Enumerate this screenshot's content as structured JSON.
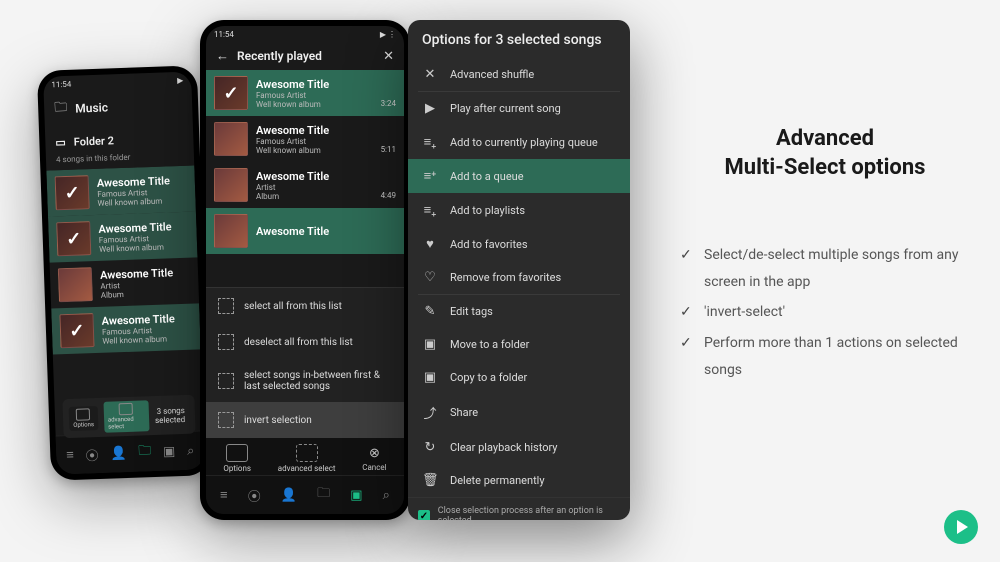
{
  "marketing": {
    "title_line1": "Advanced",
    "title_line2": "Multi-Select options",
    "bullets": [
      "Select/de-select multiple songs from any screen in the app",
      "'invert-select'",
      "Perform more than 1 actions on selected songs"
    ]
  },
  "phone1": {
    "status_time": "11:54",
    "breadcrumb": "Music",
    "folder_name": "Folder 2",
    "subtitle": "4 songs in this folder",
    "songs": [
      {
        "title": "Awesome Title",
        "artist": "Famous Artist",
        "album": "Well known album",
        "selected": true
      },
      {
        "title": "Awesome Title",
        "artist": "Famous Artist",
        "album": "Well known album",
        "selected": true
      },
      {
        "title": "Awesome Title",
        "artist": "Artist",
        "album": "Album",
        "selected": false
      },
      {
        "title": "Awesome Title",
        "artist": "Famous Artist",
        "album": "Well known album",
        "selected": true
      }
    ],
    "selection_label": "3 songs selected",
    "options_label": "Options",
    "advanced_select_label": "advanced select"
  },
  "phone2": {
    "status_time": "11:54",
    "header_title": "Recently played",
    "songs": [
      {
        "title": "Awesome Title",
        "artist": "Famous Artist",
        "album": "Well known album",
        "duration": "3:24",
        "selected": true
      },
      {
        "title": "Awesome Title",
        "artist": "Famous Artist",
        "album": "Well known album",
        "duration": "5:11",
        "selected": false
      },
      {
        "title": "Awesome Title",
        "artist": "Artist",
        "album": "Album",
        "duration": "4:49",
        "selected": false
      },
      {
        "title": "Awesome Title",
        "artist": "",
        "album": "",
        "duration": "",
        "selected": true
      }
    ],
    "sel_options": [
      "select all from this list",
      "deselect all from this list",
      "select songs in-between first & last selected songs",
      "invert selection"
    ],
    "bottom_options": "Options",
    "bottom_advanced": "advanced select",
    "bottom_cancel": "Cancel"
  },
  "panel3": {
    "header": "Options for 3 selected songs",
    "options": [
      {
        "icon": "shuffle-icon",
        "glyph": "✕",
        "label": "Advanced shuffle"
      },
      {
        "icon": "play-next-icon",
        "glyph": "▶",
        "label": "Play after current song"
      },
      {
        "icon": "queue-add-icon",
        "glyph": "≡₊",
        "label": "Add to currently playing queue"
      },
      {
        "icon": "queue-icon",
        "glyph": "≡⁺",
        "label": "Add to a queue",
        "highlight": true
      },
      {
        "icon": "playlist-add-icon",
        "glyph": "≡₊",
        "label": "Add to playlists"
      },
      {
        "icon": "heart-icon",
        "glyph": "♥",
        "label": "Add to favorites"
      },
      {
        "icon": "heart-outline-icon",
        "glyph": "♡",
        "label": "Remove from favorites"
      },
      {
        "icon": "pencil-icon",
        "glyph": "✎",
        "label": "Edit tags"
      },
      {
        "icon": "folder-move-icon",
        "glyph": "▣",
        "label": "Move to a folder"
      },
      {
        "icon": "folder-copy-icon",
        "glyph": "▣",
        "label": "Copy to a folder"
      },
      {
        "icon": "share-icon",
        "glyph": "⤴",
        "label": "Share"
      },
      {
        "icon": "history-icon",
        "glyph": "↻",
        "label": "Clear playback history"
      },
      {
        "icon": "trash-icon",
        "glyph": "🗑",
        "label": "Delete permanently"
      }
    ],
    "footer_label": "Close selection process after an option is selected"
  }
}
